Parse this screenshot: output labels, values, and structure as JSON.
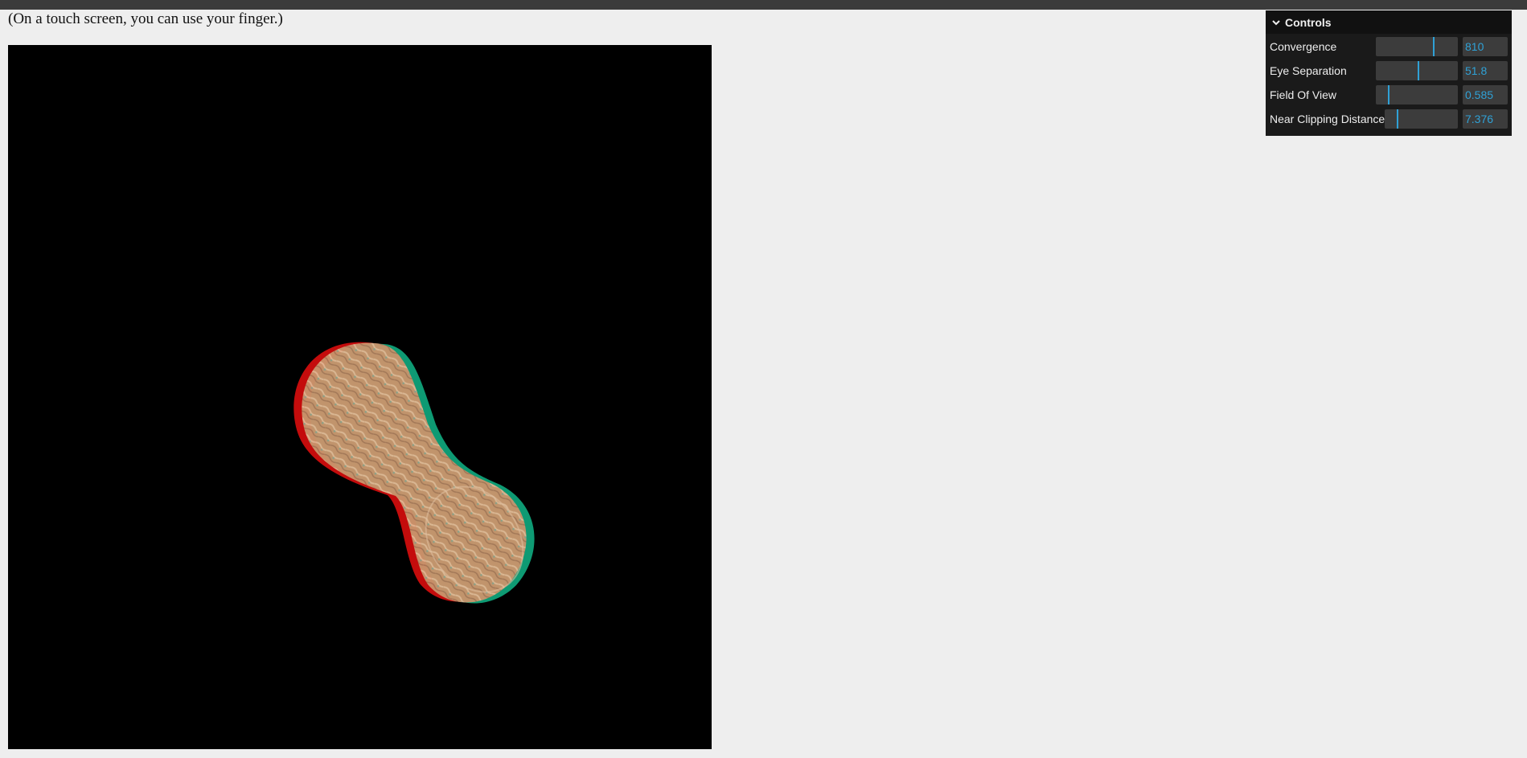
{
  "page": {
    "note": "(On a touch screen, you can use your finger.)"
  },
  "controls": {
    "title": "Controls",
    "rows": [
      {
        "label": "Convergence",
        "value": "810",
        "fraction": 0.7
      },
      {
        "label": "Eye Separation",
        "value": "51.8",
        "fraction": 0.51
      },
      {
        "label": "Field Of View",
        "value": "0.585",
        "fraction": 0.15
      },
      {
        "label": "Near Clipping Distance",
        "value": "7.376",
        "fraction": 0.16
      }
    ]
  },
  "colors": {
    "accent": "#2fa1d6",
    "panel_bg": "#1a1a1a",
    "page_bg": "#eeeeee",
    "canvas_bg": "#000000",
    "anaglyph_left": "#c40c0c",
    "anaglyph_right": "#0e9a73"
  },
  "icons": {
    "collapse": "chevron-down-icon"
  }
}
